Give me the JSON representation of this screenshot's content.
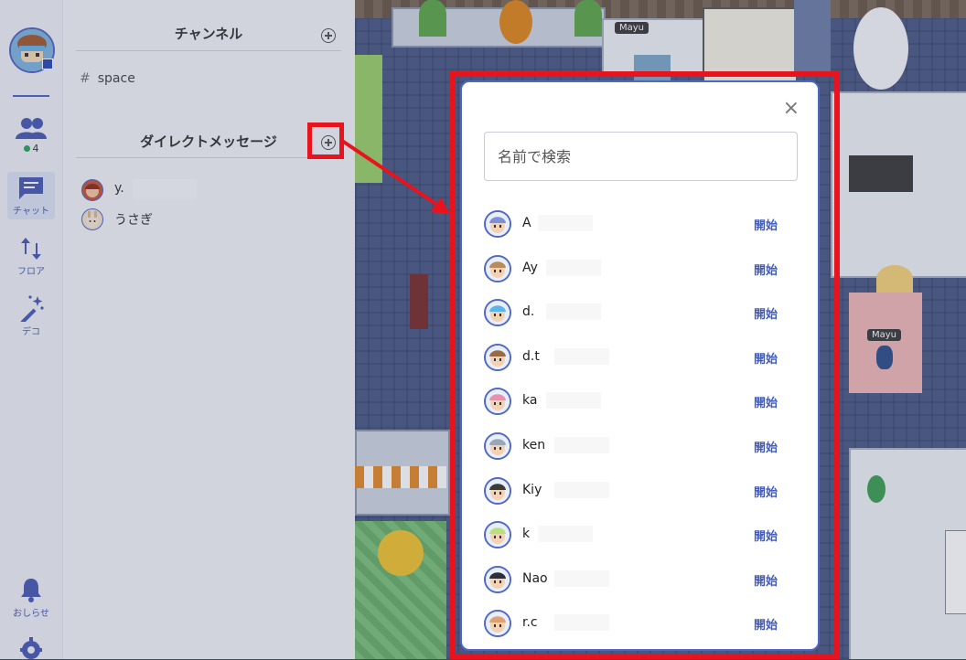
{
  "rail": {
    "members_count": "4",
    "items": [
      {
        "label": "チャット"
      },
      {
        "label": "フロア"
      },
      {
        "label": "デコ"
      },
      {
        "label": "おしらせ"
      }
    ]
  },
  "panel": {
    "channels_title": "チャンネル",
    "channels": [
      {
        "hash": "#",
        "name": "space"
      }
    ],
    "dm_title": "ダイレクトメッセージ",
    "dms": [
      {
        "name": "y."
      },
      {
        "name": "うさぎ"
      }
    ]
  },
  "map": {
    "tags": [
      "Mayu",
      "Mayu"
    ]
  },
  "modal": {
    "close_label": "×",
    "search_placeholder": "名前で検索",
    "users": [
      {
        "name": "A",
        "action": "開始",
        "avatar_color": "#7d8fd8"
      },
      {
        "name": "Ay",
        "action": "開始",
        "avatar_color": "#b98b58"
      },
      {
        "name": "d.",
        "action": "開始",
        "avatar_color": "#58b6e8"
      },
      {
        "name": "d.t",
        "action": "開始",
        "avatar_color": "#9a6a46"
      },
      {
        "name": "ka",
        "action": "開始",
        "avatar_color": "#e98fb2"
      },
      {
        "name": "ken",
        "action": "開始",
        "avatar_color": "#9aa6b8"
      },
      {
        "name": "Kiy",
        "action": "開始",
        "avatar_color": "#3b3b3b"
      },
      {
        "name": "k",
        "action": "開始",
        "avatar_color": "#b9e07e"
      },
      {
        "name": "Nao",
        "action": "開始",
        "avatar_color": "#2f2f3a"
      },
      {
        "name": "r.c",
        "action": "開始",
        "avatar_color": "#e0a070"
      }
    ]
  },
  "colors": {
    "accent": "#4f68c7",
    "callout": "#e8131c",
    "action_text": "#3e5bc4"
  }
}
